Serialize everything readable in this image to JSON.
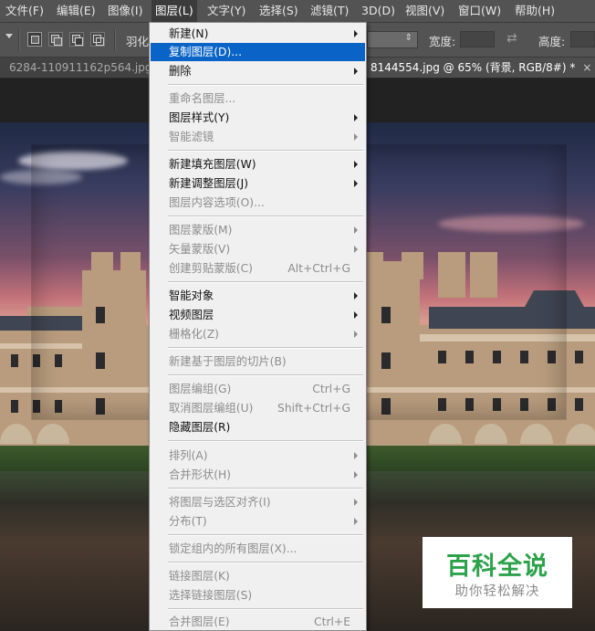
{
  "menubar": {
    "items": [
      {
        "label": "文件(F)"
      },
      {
        "label": "编辑(E)"
      },
      {
        "label": "图像(I)"
      },
      {
        "label": "图层(L)"
      },
      {
        "label": "文字(Y)"
      },
      {
        "label": "选择(S)"
      },
      {
        "label": "滤镜(T)"
      },
      {
        "label": "3D(D)"
      },
      {
        "label": "视图(V)"
      },
      {
        "label": "窗口(W)"
      },
      {
        "label": "帮助(H)"
      }
    ]
  },
  "options_bar": {
    "feather_label": "羽化",
    "width_label": "宽度:",
    "height_label": "高度:"
  },
  "tabs": [
    {
      "label": "6284-110911162p564.jpg @"
    },
    {
      "label": "8144554.jpg @ 65% (背景, RGB/8#) *",
      "close": "×"
    }
  ],
  "layer_menu": {
    "items": [
      {
        "label": "新建(N)",
        "shortcut": "",
        "submenu": true,
        "disabled": false
      },
      {
        "label": "复制图层(D)...",
        "shortcut": "",
        "submenu": false,
        "disabled": false,
        "highlighted": true
      },
      {
        "label": "删除",
        "shortcut": "",
        "submenu": true,
        "disabled": false
      },
      {
        "label": "重命名图层...",
        "shortcut": "",
        "submenu": false,
        "disabled": true
      },
      {
        "label": "图层样式(Y)",
        "shortcut": "",
        "submenu": true,
        "disabled": false
      },
      {
        "label": "智能滤镜",
        "shortcut": "",
        "submenu": true,
        "disabled": true
      },
      {
        "label": "新建填充图层(W)",
        "shortcut": "",
        "submenu": true,
        "disabled": false
      },
      {
        "label": "新建调整图层(J)",
        "shortcut": "",
        "submenu": true,
        "disabled": false
      },
      {
        "label": "图层内容选项(O)...",
        "shortcut": "",
        "submenu": false,
        "disabled": true
      },
      {
        "label": "图层蒙版(M)",
        "shortcut": "",
        "submenu": true,
        "disabled": true
      },
      {
        "label": "矢量蒙版(V)",
        "shortcut": "",
        "submenu": true,
        "disabled": true
      },
      {
        "label": "创建剪贴蒙版(C)",
        "shortcut": "Alt+Ctrl+G",
        "submenu": false,
        "disabled": true
      },
      {
        "label": "智能对象",
        "shortcut": "",
        "submenu": true,
        "disabled": false
      },
      {
        "label": "视频图层",
        "shortcut": "",
        "submenu": true,
        "disabled": false
      },
      {
        "label": "栅格化(Z)",
        "shortcut": "",
        "submenu": true,
        "disabled": true
      },
      {
        "label": "新建基于图层的切片(B)",
        "shortcut": "",
        "submenu": false,
        "disabled": true
      },
      {
        "label": "图层编组(G)",
        "shortcut": "Ctrl+G",
        "submenu": false,
        "disabled": true
      },
      {
        "label": "取消图层编组(U)",
        "shortcut": "Shift+Ctrl+G",
        "submenu": false,
        "disabled": true
      },
      {
        "label": "隐藏图层(R)",
        "shortcut": "",
        "submenu": false,
        "disabled": false
      },
      {
        "label": "排列(A)",
        "shortcut": "",
        "submenu": true,
        "disabled": true
      },
      {
        "label": "合并形状(H)",
        "shortcut": "",
        "submenu": true,
        "disabled": true
      },
      {
        "label": "将图层与选区对齐(I)",
        "shortcut": "",
        "submenu": true,
        "disabled": true
      },
      {
        "label": "分布(T)",
        "shortcut": "",
        "submenu": true,
        "disabled": true
      },
      {
        "label": "锁定组内的所有图层(X)...",
        "shortcut": "",
        "submenu": false,
        "disabled": true
      },
      {
        "label": "链接图层(K)",
        "shortcut": "",
        "submenu": false,
        "disabled": true
      },
      {
        "label": "选择链接图层(S)",
        "shortcut": "",
        "submenu": false,
        "disabled": true
      },
      {
        "label": "合并图层(E)",
        "shortcut": "Ctrl+E",
        "submenu": false,
        "disabled": true
      }
    ]
  },
  "watermark": {
    "title": "百科全说",
    "subtitle": "助你轻松解决"
  },
  "colors": {
    "menu_highlight": "#0a64c7",
    "watermark_green": "#2ca24a"
  }
}
